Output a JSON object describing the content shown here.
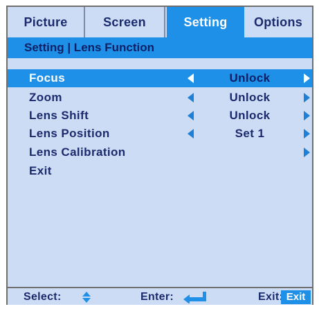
{
  "tabs": [
    {
      "label": "Picture"
    },
    {
      "label": "Screen"
    },
    {
      "label": "Setting"
    },
    {
      "label": "Options"
    }
  ],
  "active_tab": "Setting",
  "header": {
    "title": "Setting | Lens Function"
  },
  "menu": {
    "items": [
      {
        "label": "Focus",
        "value": "Unlock",
        "selected": true
      },
      {
        "label": "Zoom",
        "value": "Unlock"
      },
      {
        "label": "Lens Shift",
        "value": "Unlock"
      },
      {
        "label": "Lens Position",
        "value": "Set 1"
      },
      {
        "label": "Lens Calibration",
        "value": ""
      },
      {
        "label": "Exit",
        "value": ""
      }
    ]
  },
  "footer": {
    "select_label": "Select:",
    "enter_label": "Enter:",
    "exit_label": "Exit:",
    "exit_key": "Exit"
  },
  "colors": {
    "panel_bg": "#ccdcf5",
    "accent": "#1e90e8",
    "text": "#1a2a6c",
    "border": "#6f6f6f"
  },
  "icons": [
    "left-arrow-icon",
    "right-arrow-icon",
    "up-down-arrow-icon",
    "enter-return-icon"
  ]
}
